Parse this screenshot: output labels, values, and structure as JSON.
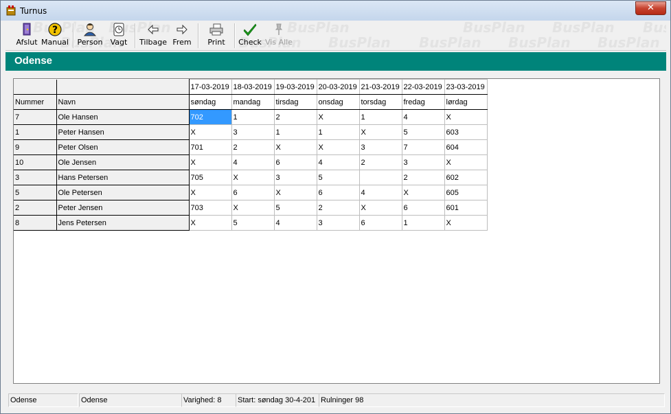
{
  "window": {
    "title": "Turnus",
    "close_label": "✕"
  },
  "toolbar": {
    "watermark": "BusPlan",
    "buttons": [
      {
        "label": "Afslut",
        "icon": "exit-icon"
      },
      {
        "label": "Manual",
        "icon": "help-icon"
      },
      {
        "label": "Person",
        "icon": "person-icon"
      },
      {
        "label": "Vagt",
        "icon": "clock-icon"
      },
      {
        "label": "Tilbage",
        "icon": "arrow-left-icon"
      },
      {
        "label": "Frem",
        "icon": "arrow-right-icon"
      },
      {
        "label": "Print",
        "icon": "printer-icon"
      },
      {
        "label": "Check",
        "icon": "checkmark-icon"
      },
      {
        "label": "Vis Alle",
        "icon": "pin-icon",
        "disabled": true
      }
    ]
  },
  "header": {
    "title": "Odense"
  },
  "grid": {
    "col_headers": {
      "number": "Nummer",
      "name": "Navn",
      "dates": [
        "17-03-2019",
        "18-03-2019",
        "19-03-2019",
        "20-03-2019",
        "21-03-2019",
        "22-03-2019",
        "23-03-2019"
      ],
      "weekdays": [
        "søndag",
        "mandag",
        "tirsdag",
        "onsdag",
        "torsdag",
        "fredag",
        "lørdag"
      ]
    },
    "rows": [
      {
        "number": "7",
        "name": "Ole Hansen",
        "cells": [
          "702",
          "1",
          "2",
          "X",
          "1",
          "4",
          "X"
        ]
      },
      {
        "number": "1",
        "name": "Peter Hansen",
        "cells": [
          "X",
          "3",
          "1",
          "1",
          "X",
          "5",
          "603"
        ]
      },
      {
        "number": "9",
        "name": "Peter Olsen",
        "cells": [
          "701",
          "2",
          "X",
          "X",
          "3",
          "7",
          "604"
        ]
      },
      {
        "number": "10",
        "name": "Ole Jensen",
        "cells": [
          "X",
          "4",
          "6",
          "4",
          "2",
          "3",
          "X"
        ]
      },
      {
        "number": "3",
        "name": "Hans Petersen",
        "cells": [
          "705",
          "X",
          "3",
          "5",
          "",
          "2",
          "602"
        ]
      },
      {
        "number": "5",
        "name": "Ole Petersen",
        "cells": [
          "X",
          "6",
          "X",
          "6",
          "4",
          "X",
          "605"
        ]
      },
      {
        "number": "2",
        "name": "Peter Jensen",
        "cells": [
          "703",
          "X",
          "5",
          "2",
          "X",
          "6",
          "601"
        ]
      },
      {
        "number": "8",
        "name": "Jens Petersen",
        "cells": [
          "X",
          "5",
          "4",
          "3",
          "6",
          "1",
          "X"
        ]
      }
    ],
    "selected": {
      "row": 0,
      "col": 0
    }
  },
  "statusbar": {
    "fields": [
      "Odense",
      "Odense",
      "Varighed: 8",
      "Start: søndag 30-4-201",
      "Rulninger 98"
    ]
  },
  "colors": {
    "accent": "#00847a",
    "selection": "#3399ff"
  }
}
